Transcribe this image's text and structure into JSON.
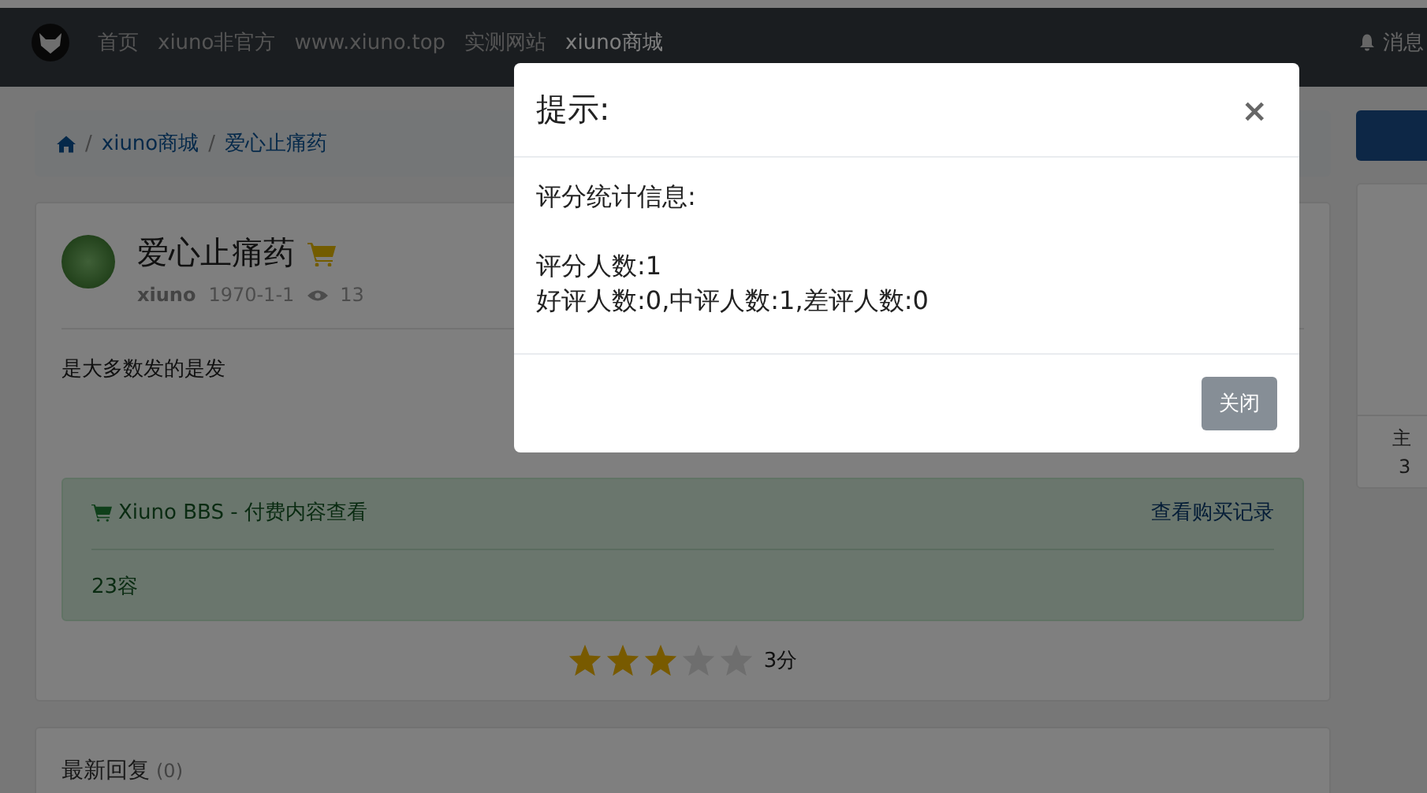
{
  "navbar": {
    "items": [
      {
        "label": "首页",
        "selected": false
      },
      {
        "label": "xiuno非官方",
        "selected": false
      },
      {
        "label": "www.xiuno.top",
        "selected": false
      },
      {
        "label": "实测网站",
        "selected": false
      },
      {
        "label": "xiuno商城",
        "selected": true
      }
    ],
    "messages": "消息"
  },
  "breadcrumb": {
    "separator": "/",
    "items": [
      "xiuno商城",
      "爱心止痛药"
    ]
  },
  "post": {
    "title": "爱心止痛药",
    "author": "xiuno",
    "date": "1970-1-1",
    "views": "13",
    "body": "是大多数发的是发",
    "paid": {
      "title": "Xiuno BBS - 付费内容查看",
      "link": "查看购买记录",
      "content": "23容"
    },
    "rating": {
      "stars": 3,
      "label": "3分"
    }
  },
  "replies": {
    "title": "最新回复",
    "count": "(0)"
  },
  "sidebar": {
    "stat_label": "主",
    "stat_value": "3"
  },
  "modal": {
    "title": "提示:",
    "close": "×",
    "heading": "评分统计信息:",
    "lines": [
      "评分人数:1",
      "好评人数:0,中评人数:1,差评人数:0"
    ],
    "button": "关闭"
  }
}
